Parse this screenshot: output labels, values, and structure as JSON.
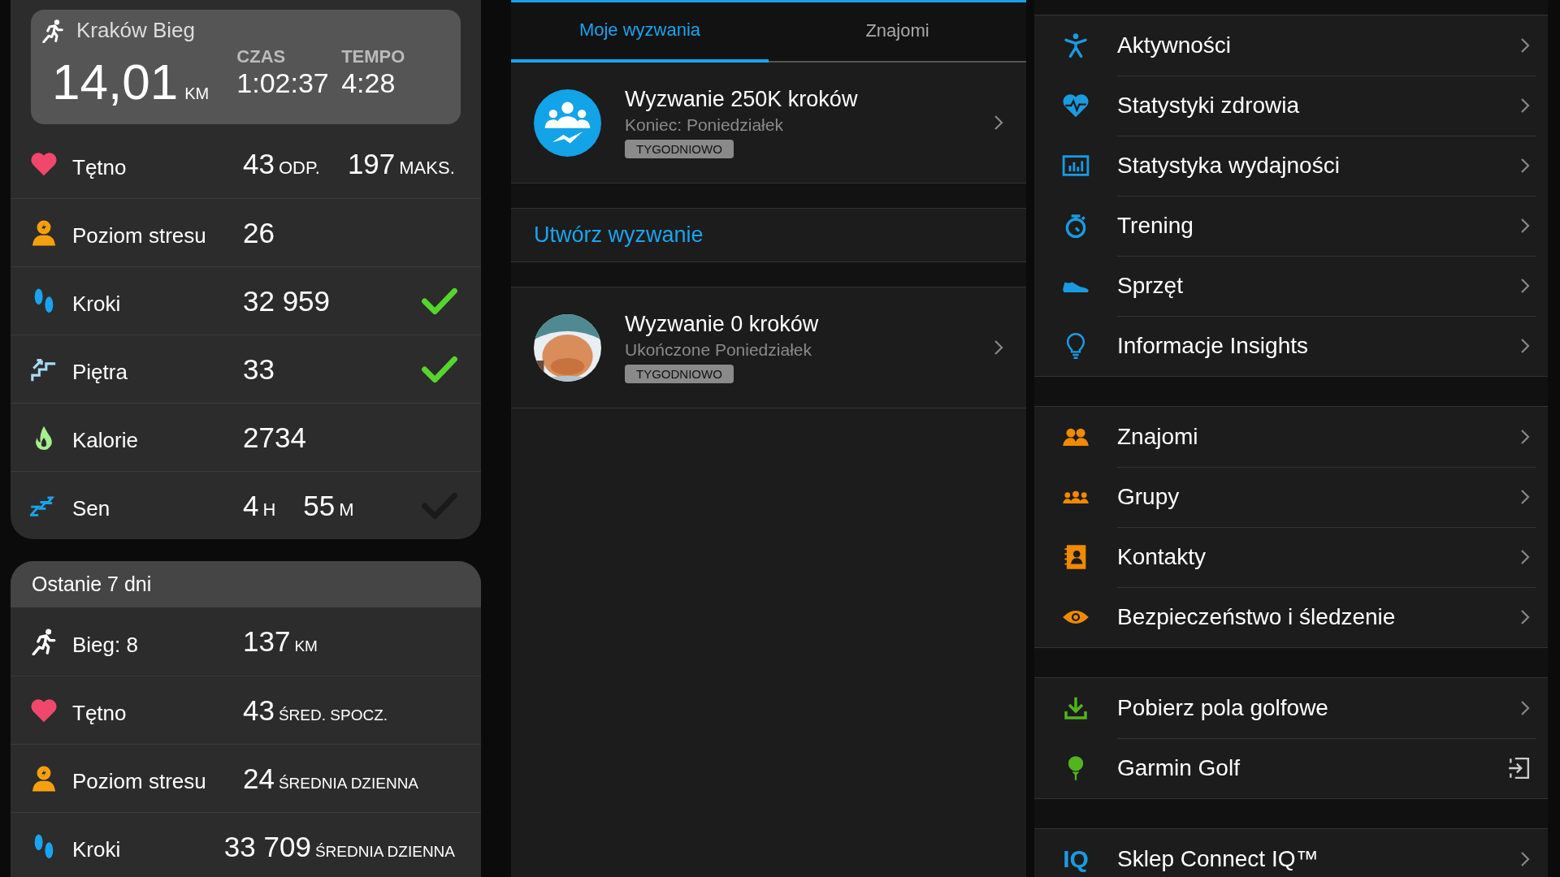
{
  "activity": {
    "kind": "run",
    "title": "Kraków Bieg",
    "distance": "14,01",
    "distance_unit": "KM",
    "stats": [
      {
        "label": "CZAS",
        "value": "1:02:37"
      },
      {
        "label": "TEMPO",
        "value": "4:28"
      }
    ]
  },
  "today": [
    {
      "kind": "heart",
      "label": "Tętno",
      "values": [
        {
          "number": "43",
          "unit": "ODP."
        },
        {
          "number": "197",
          "unit": "MAKS."
        }
      ]
    },
    {
      "kind": "stress",
      "label": "Poziom stresu",
      "values": [
        {
          "number": "26"
        }
      ]
    },
    {
      "kind": "steps",
      "label": "Kroki",
      "values": [
        {
          "number": "32 959"
        }
      ],
      "goal_met": true
    },
    {
      "kind": "floors",
      "label": "Piętra",
      "values": [
        {
          "number": "33"
        }
      ],
      "goal_met": true
    },
    {
      "kind": "calories",
      "label": "Kalorie",
      "values": [
        {
          "number": "2734"
        }
      ]
    },
    {
      "kind": "sleep",
      "label": "Sen",
      "values": [
        {
          "number": "4",
          "unit": "H"
        },
        {
          "number": "55",
          "unit": "M"
        }
      ],
      "goal_met": false
    }
  ],
  "last_7_days": {
    "title": "Ostanie 7 dni",
    "rows": [
      {
        "kind": "run",
        "label": "Bieg: 8",
        "values": [
          {
            "number": "137",
            "unit": "KM"
          }
        ]
      },
      {
        "kind": "heart",
        "label": "Tętno",
        "values": [
          {
            "number": "43",
            "unit": "ŚRED. SPOCZ."
          }
        ]
      },
      {
        "kind": "stress",
        "label": "Poziom stresu",
        "values": [
          {
            "number": "24",
            "unit": "ŚREDNIA DZIENNA"
          }
        ]
      },
      {
        "kind": "steps",
        "label": "Kroki",
        "values": [
          {
            "number": "33 709",
            "unit": "ŚREDNIA DZIENNA"
          }
        ]
      }
    ]
  },
  "tabs": [
    {
      "label": "Moje wyzwania",
      "selected": true
    },
    {
      "label": "Znajomi",
      "selected": false
    }
  ],
  "challenges": [
    {
      "kind": "group",
      "title": "Wyzwanie 250K kroków",
      "subtitle": "Koniec: Poniedziałek",
      "tag": "TYGODNIOWO"
    },
    {
      "kind": "create",
      "label": "Utwórz wyzwanie"
    },
    {
      "kind": "picture",
      "title": "Wyzwanie 0 kroków",
      "subtitle": "Ukończone Poniedziałek",
      "tag": "TYGODNIOWO"
    }
  ],
  "menu_sections": [
    {
      "color": "#1a9be0",
      "items": [
        {
          "kind": "activity",
          "label": "Aktywności",
          "external": false
        },
        {
          "kind": "health",
          "label": "Statystyki zdrowia",
          "external": false
        },
        {
          "kind": "chart",
          "label": "Statystyka wydajności",
          "external": false
        },
        {
          "kind": "timer",
          "label": "Trening",
          "external": false
        },
        {
          "kind": "shoe",
          "label": "Sprzęt",
          "external": false
        },
        {
          "kind": "bulb",
          "label": "Informacje Insights",
          "external": false
        }
      ]
    },
    {
      "color": "#f08a00",
      "items": [
        {
          "kind": "friends",
          "label": "Znajomi",
          "external": false
        },
        {
          "kind": "groups",
          "label": "Grupy",
          "external": false
        },
        {
          "kind": "contacts",
          "label": "Kontakty",
          "external": false
        },
        {
          "kind": "eye",
          "label": "Bezpieczeństwo i śledzenie",
          "external": false
        }
      ]
    },
    {
      "color": "#52b51e",
      "items": [
        {
          "kind": "download",
          "label": "Pobierz pola golfowe",
          "external": false
        },
        {
          "kind": "golf",
          "label": "Garmin Golf",
          "external": true
        }
      ]
    },
    {
      "color": "#1a9be0",
      "items": [
        {
          "kind": "text",
          "icon_text": "IQ",
          "label": "Sklep Connect IQ™",
          "external": false
        }
      ]
    }
  ]
}
